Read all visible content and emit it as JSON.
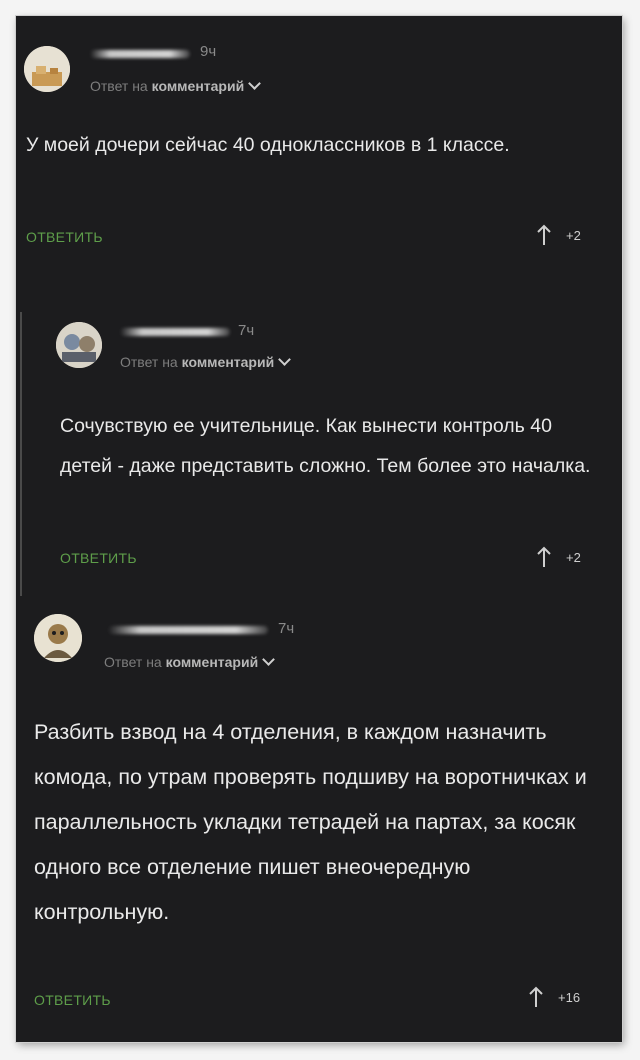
{
  "comments": [
    {
      "time": "9ч",
      "reply_to_prefix": "Ответ на",
      "reply_to_link": "комментарий",
      "text": "У моей дочери сейчас 40 одноклассников в 1 классе.",
      "reply_label": "ОТВЕТИТЬ",
      "score": "+2"
    },
    {
      "time": "7ч",
      "reply_to_prefix": "Ответ на",
      "reply_to_link": "комментарий",
      "text": "Сочувствую ее учительнице. Как вынести контроль 40 детей - даже представить сложно. Тем более это началка.",
      "reply_label": "ОТВЕТИТЬ",
      "score": "+2"
    },
    {
      "time": "7ч",
      "reply_to_prefix": "Ответ на",
      "reply_to_link": "комментарий",
      "text": "Разбить взвод на 4 отделения, в каждом назначить комода, по утрам проверять подшиву на воротничках и параллельность укладки тетрадей на партах, за косяк одного все отделение пишет внеочередную контрольную.",
      "reply_label": "ОТВЕТИТЬ",
      "score": "+16"
    }
  ],
  "colors": {
    "background": "#1c1c1e",
    "reply_button": "#5e9e4a",
    "text": "#e9e9e9"
  }
}
